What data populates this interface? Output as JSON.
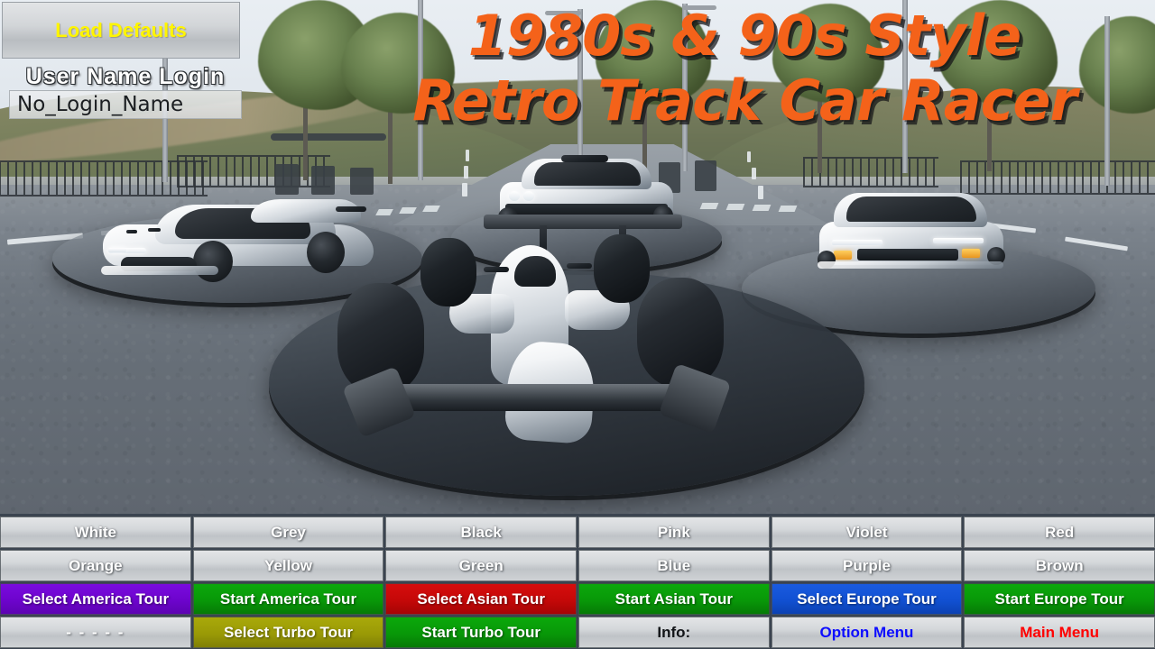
{
  "title": {
    "line1": "1980s & 90s Style",
    "line2": "Retro Track Car Racer",
    "color": "#F4621A"
  },
  "top_panel": {
    "load_defaults_label": "Load Defaults",
    "load_defaults_color": "#FFF500",
    "login_label": "User  Name  Login",
    "login_value": "No_Login_Name",
    "login_placeholder": "No_Login_Name"
  },
  "colors": {
    "violet": "#6D04CC",
    "green": "#089808",
    "red": "#C40808",
    "blue": "#1150D2",
    "olive": "#9A9A06",
    "grey": "#D4D7DA",
    "main_menu_text": "#FF0000",
    "option_menu_text": "#0D0DFF",
    "info_text": "#111417"
  },
  "button_grid": {
    "rows": [
      [
        {
          "label": "White",
          "style": "grey"
        },
        {
          "label": "Grey",
          "style": "grey"
        },
        {
          "label": "Black",
          "style": "grey"
        },
        {
          "label": "Pink",
          "style": "grey"
        },
        {
          "label": "Violet",
          "style": "grey"
        },
        {
          "label": "Red",
          "style": "grey"
        }
      ],
      [
        {
          "label": "Orange",
          "style": "grey"
        },
        {
          "label": "Yellow",
          "style": "grey"
        },
        {
          "label": "Green",
          "style": "grey"
        },
        {
          "label": "Blue",
          "style": "grey"
        },
        {
          "label": "Purple",
          "style": "grey"
        },
        {
          "label": "Brown",
          "style": "grey"
        }
      ],
      [
        {
          "label": "Select America Tour",
          "style": "violet"
        },
        {
          "label": "Start America Tour",
          "style": "green"
        },
        {
          "label": "Select Asian Tour",
          "style": "red"
        },
        {
          "label": "Start Asian Tour",
          "style": "green"
        },
        {
          "label": "Select Europe Tour",
          "style": "blue"
        },
        {
          "label": "Start Europe Tour",
          "style": "green"
        }
      ],
      [
        {
          "label": "- - - - -",
          "style": "grey dashes"
        },
        {
          "label": "Select Turbo Tour",
          "style": "olive"
        },
        {
          "label": "Start Turbo Tour",
          "style": "green"
        },
        {
          "label": "Info:",
          "style": "grey dark-text"
        },
        {
          "label": "Option Menu",
          "style": "grey blue-text"
        },
        {
          "label": "Main Menu",
          "style": "grey red-text"
        }
      ]
    ]
  },
  "scene": {
    "description": "Three white showroom cars on circular turntables plus a white open-wheel formula car on a large dark turntable, on an asphalt road with trees, hills, fencing and street lamps",
    "vehicles": [
      {
        "name": "supercar",
        "position": "left"
      },
      {
        "name": "muscle-coupe",
        "position": "center-back"
      },
      {
        "name": "retro-sports-car",
        "position": "right"
      },
      {
        "name": "formula-car",
        "position": "center-front"
      }
    ]
  }
}
